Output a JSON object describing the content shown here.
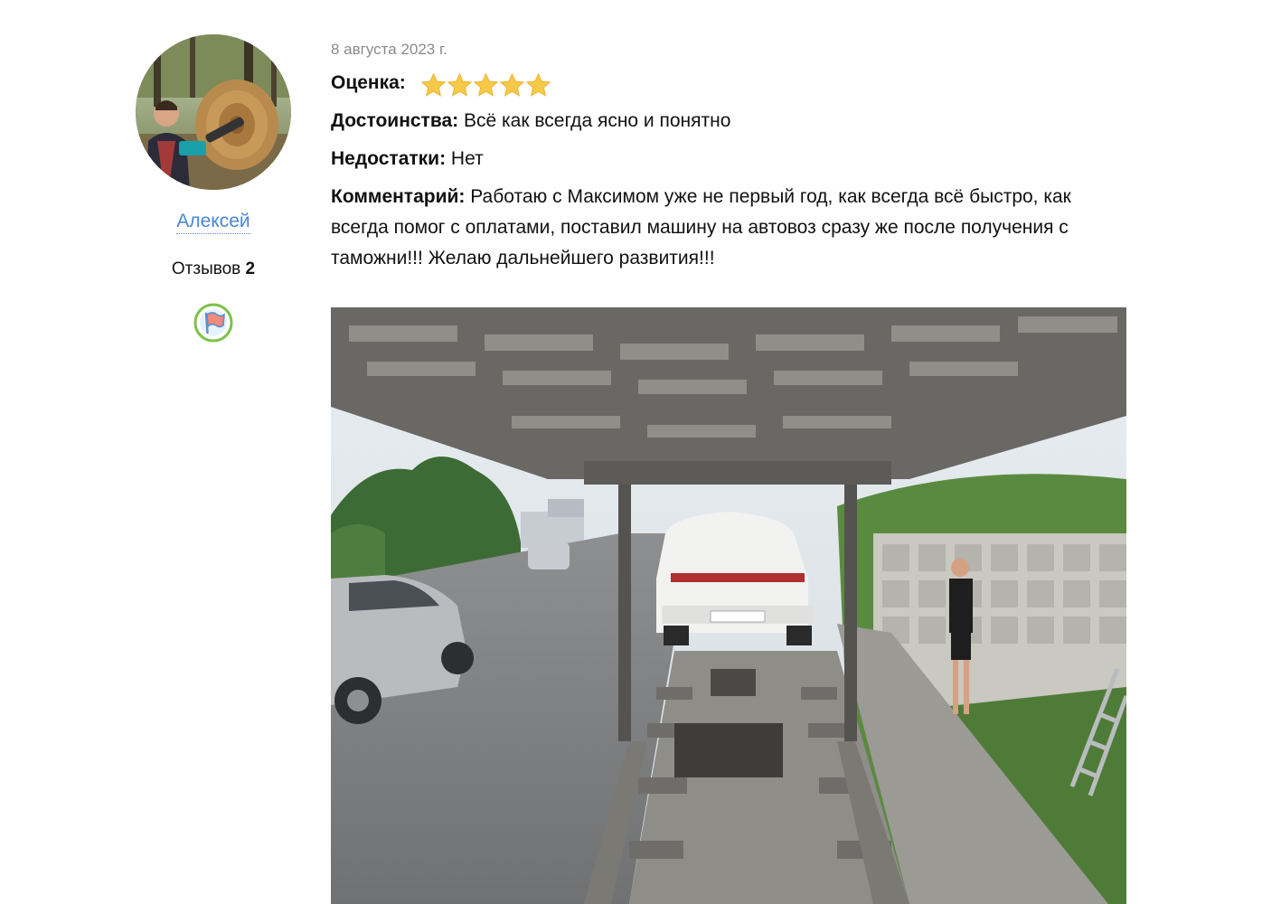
{
  "author": {
    "name": "Алексей",
    "reviews_label": "Отзывов",
    "reviews_count": "2"
  },
  "review": {
    "date": "8 августа 2023 г.",
    "rating_label": "Оценка:",
    "rating_value": 5,
    "rating_max": 5,
    "advantages_label": "Достоинства:",
    "advantages_text": "Всё как всегда ясно и понятно",
    "disadvantages_label": "Недостатки:",
    "disadvantages_text": "Нет",
    "comment_label": "Комментарий:",
    "comment_text": "Работаю с Максимом уже не первый год, как всегда всё быстро, как всегда помог с оплатами, поставил машину на автовоз сразу же после получения с таможни!!! Желаю дальнейшего развития!!!"
  },
  "colors": {
    "link": "#4a86d4",
    "date": "#8a8a8a",
    "star": "#f7c948"
  },
  "icons": {
    "badge": "flag-badge-icon",
    "star": "star-icon"
  }
}
